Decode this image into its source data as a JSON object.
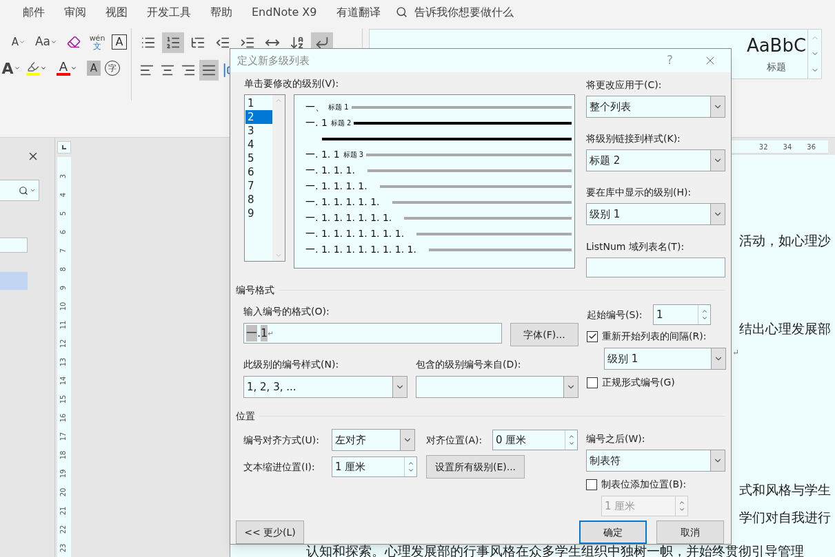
{
  "menu_tabs": [
    "邮件",
    "审阅",
    "视图",
    "开发工具",
    "帮助",
    "EndNote X9",
    "有道翻译"
  ],
  "tell_me": {
    "placeholder": "告诉我你想要做什么"
  },
  "font_group": {
    "row1": [
      {
        "kind": "shrink",
        "text": "A"
      },
      {
        "kind": "case",
        "text": "Aa"
      },
      {
        "kind": "clear"
      },
      {
        "kind": "phonetic",
        "text": "wén",
        "sub": "文"
      },
      {
        "kind": "boxed",
        "text": "A"
      }
    ],
    "row2": [
      {
        "kind": "effect",
        "text": "A"
      },
      {
        "kind": "highlight",
        "color": "#ffff00"
      },
      {
        "kind": "font_color",
        "text": "A",
        "color": "#ff0000"
      },
      {
        "kind": "shaded",
        "text": "A"
      },
      {
        "kind": "enclosed",
        "text": "字"
      }
    ]
  },
  "paragraph_group": {
    "row1": [
      {
        "kind": "bullets",
        "selected": false
      },
      {
        "kind": "numbering",
        "selected": true
      },
      {
        "kind": "multilevel",
        "selected": false
      },
      {
        "kind": "outdent",
        "selected": false
      },
      {
        "kind": "indent",
        "selected": false
      },
      {
        "kind": "layout",
        "selected": false
      },
      {
        "kind": "sort",
        "selected": false
      },
      {
        "kind": "marks",
        "selected": true
      }
    ],
    "row2": [
      {
        "kind": "left",
        "selected": false
      },
      {
        "kind": "center",
        "selected": false
      },
      {
        "kind": "right",
        "selected": false
      },
      {
        "kind": "justify",
        "selected": true
      },
      {
        "kind": "distributed"
      }
    ]
  },
  "style_gallery": [
    {
      "kind": "large",
      "sample": "AaBbC",
      "label": "标题"
    }
  ],
  "vertical_ruler": [
    "3",
    "4",
    "5",
    "6",
    "7",
    "8",
    "9",
    "10",
    "11",
    "12",
    "13",
    "14",
    "15",
    "16",
    "17",
    "18",
    "19",
    "20",
    "21",
    "22",
    "23"
  ],
  "horizontal_ruler": [
    "32",
    "34",
    "36"
  ],
  "document": {
    "fragments": [
      {
        "kind": "text",
        "text": "活动，如心理沙"
      },
      {
        "kind": "text",
        "text": "结出心理发展部"
      },
      {
        "kind": "mark",
        "text": "↵"
      },
      {
        "kind": "text",
        "text": "式和风格与学生"
      },
      {
        "kind": "text",
        "text": "学们对自我进行"
      }
    ],
    "bottom_line": "认知和探索。心理发展部的行事风格在众多学生组织中独树一帜，并始终贯彻引导管理"
  },
  "dialog": {
    "title": "定义新多级列表",
    "help": "?",
    "level_list_label": "单击要修改的级别(V):",
    "levels": [
      {
        "label": "1",
        "selected": false,
        "number": "一、",
        "style": "标题 1"
      },
      {
        "label": "2",
        "selected": true,
        "number": "一. 1",
        "style": "标题 2"
      },
      {
        "label": "3",
        "selected": false,
        "number": "一. 1. 1",
        "style": "标题 3"
      },
      {
        "label": "4",
        "selected": false,
        "number": "一. 1. 1. 1."
      },
      {
        "label": "5",
        "selected": false,
        "number": "一. 1. 1. 1. 1."
      },
      {
        "label": "6",
        "selected": false,
        "number": "一. 1. 1. 1. 1. 1."
      },
      {
        "label": "7",
        "selected": false,
        "number": "一. 1. 1. 1. 1. 1. 1."
      },
      {
        "label": "8",
        "selected": false,
        "number": "一. 1. 1. 1. 1. 1. 1. 1."
      },
      {
        "label": "9",
        "selected": false,
        "number": "一. 1. 1. 1. 1. 1. 1. 1. 1."
      }
    ],
    "apply_to": {
      "label": "将更改应用于(C):",
      "value": "整个列表"
    },
    "link_style": {
      "label": "将级别链接到样式(K):",
      "value": "标题 2"
    },
    "gallery_level": {
      "label": "要在库中显示的级别(H):",
      "value": "级别 1"
    },
    "listnum": {
      "label": "ListNum 域列表名(T):"
    },
    "format_section": "编号格式",
    "format_input": {
      "label": "输入编号的格式(O):",
      "parts": [
        {
          "text": "一",
          "shaded": true
        },
        {
          "text": ".",
          "shaded": false
        },
        {
          "text": "1",
          "shaded": true
        }
      ],
      "mark": "↵"
    },
    "font_button": "字体(F)...",
    "start_at": {
      "label": "起始编号(S):",
      "value": "1"
    },
    "restart": {
      "label": "重新开始列表的间隔(R):",
      "checked": true,
      "value": "级别 1"
    },
    "number_style": {
      "label": "此级别的编号样式(N):",
      "value": "1, 2, 3, ..."
    },
    "include_from": {
      "label": "包含的级别编号来自(D):"
    },
    "legal": {
      "label": "正规形式编号(G)",
      "checked": false
    },
    "position_section": "位置",
    "alignment": {
      "label": "编号对齐方式(U):",
      "value": "左对齐"
    },
    "aligned_at": {
      "label": "对齐位置(A):",
      "value": "0 厘米"
    },
    "indent_at": {
      "label": "文本缩进位置(I):",
      "value": "1 厘米"
    },
    "set_all_button": "设置所有级别(E)...",
    "follow_with": {
      "label": "编号之后(W):",
      "value": "制表符"
    },
    "add_tab": {
      "label": "制表位添加位置(B):",
      "checked": false,
      "value": "1 厘米",
      "disabled": true
    },
    "less_button": "<< 更少(L)",
    "ok_button": "确定",
    "cancel_button": "取消"
  }
}
